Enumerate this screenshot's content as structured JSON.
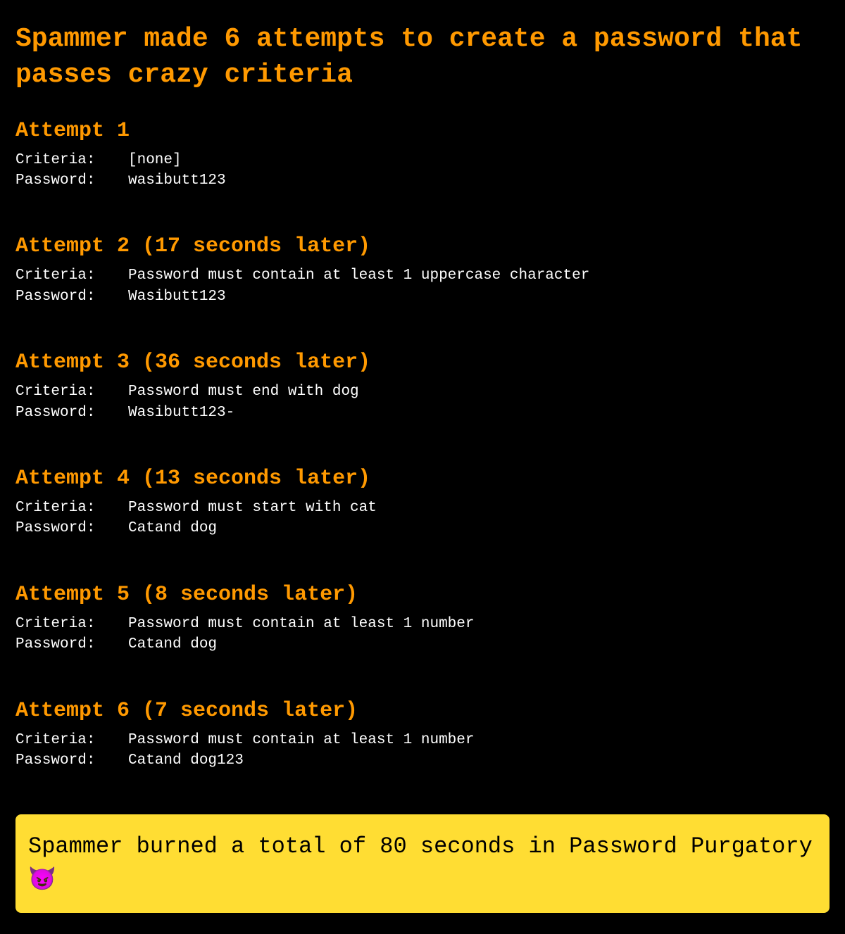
{
  "title": "Spammer made 6 attempts to create a password that passes crazy criteria",
  "labels": {
    "criteria": "Criteria:",
    "password": "Password:"
  },
  "attempts": [
    {
      "heading": "Attempt 1",
      "criteria": "[none]",
      "password": "wasibutt123"
    },
    {
      "heading": "Attempt 2 (17 seconds later)",
      "criteria": "Password must contain at least 1 uppercase character",
      "password": "Wasibutt123"
    },
    {
      "heading": "Attempt 3 (36 seconds later)",
      "criteria": "Password must end with dog",
      "password": "Wasibutt123-"
    },
    {
      "heading": "Attempt 4 (13 seconds later)",
      "criteria": "Password must start with cat",
      "password": "Catand dog"
    },
    {
      "heading": "Attempt 5 (8 seconds later)",
      "criteria": "Password must contain at least 1 number",
      "password": "Catand dog"
    },
    {
      "heading": "Attempt 6 (7 seconds later)",
      "criteria": "Password must contain at least 1 number",
      "password": "Catand dog123"
    }
  ],
  "summary": "Spammer burned a total of 80 seconds in Password Purgatory 😈"
}
